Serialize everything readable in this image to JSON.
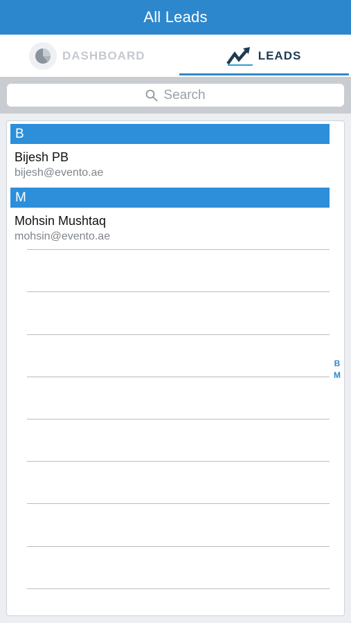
{
  "nav": {
    "title": "All Leads"
  },
  "tabs": {
    "dashboard": {
      "label": "DASHBOARD",
      "icon": "pie-chart-icon"
    },
    "leads": {
      "label": "LEADS",
      "icon": "trending-up-icon",
      "selected": true
    }
  },
  "search": {
    "placeholder": "Search",
    "icon": "search-icon"
  },
  "sections": [
    {
      "letter": "B",
      "leads": [
        {
          "name": "Bijesh PB",
          "email": "bijesh@evento.ae"
        }
      ]
    },
    {
      "letter": "M",
      "leads": [
        {
          "name": "Mohsin Mushtaq",
          "email": "mohsin@evento.ae"
        }
      ]
    }
  ],
  "index": [
    "B",
    "M"
  ],
  "colors": {
    "accent": "#2d87cc",
    "section_header": "#2d8fd9",
    "leads_tab_text": "#1f3b4f",
    "inactive_tab_text": "#c5c9ce"
  }
}
